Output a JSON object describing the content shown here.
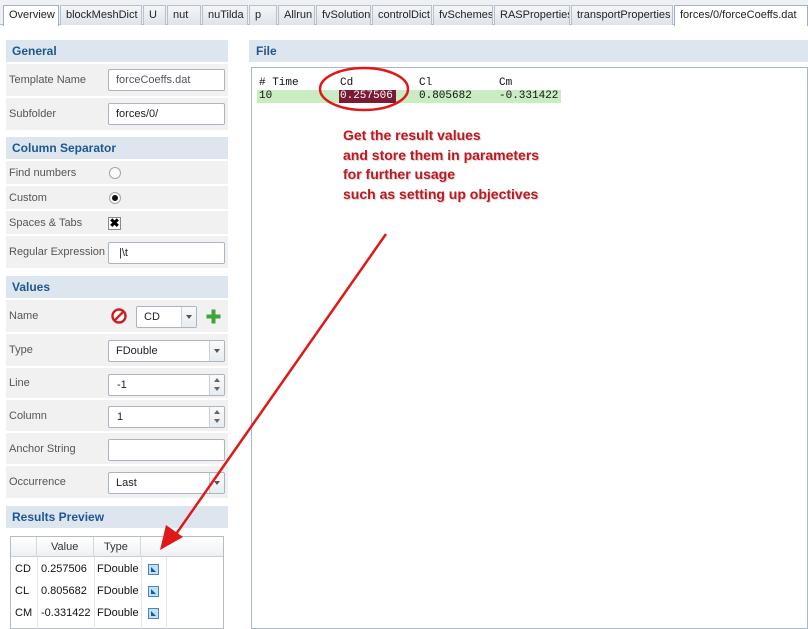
{
  "tabs": [
    {
      "label": "Overview",
      "active": true
    },
    {
      "label": "blockMeshDict",
      "active": false
    },
    {
      "label": "U",
      "active": false
    },
    {
      "label": "nut",
      "active": false
    },
    {
      "label": "nuTilda",
      "active": false
    },
    {
      "label": "p",
      "active": false
    },
    {
      "label": "Allrun",
      "active": false
    },
    {
      "label": "fvSolution",
      "active": false
    },
    {
      "label": "controlDict",
      "active": false
    },
    {
      "label": "fvSchemes",
      "active": false
    },
    {
      "label": "RASProperties",
      "active": false
    },
    {
      "label": "transportProperties",
      "active": false
    },
    {
      "label": "forces/0/forceCoeffs.dat",
      "active": true
    }
  ],
  "general": {
    "title": "General",
    "template_name_label": "Template Name",
    "template_name_value": "forceCoeffs.dat",
    "subfolder_label": "Subfolder",
    "subfolder_value": "forces/0/"
  },
  "column_separator": {
    "title": "Column Separator",
    "find_numbers_label": "Find numbers",
    "find_numbers_selected": false,
    "custom_label": "Custom",
    "custom_selected": true,
    "spaces_tabs_label": "Spaces & Tabs",
    "spaces_tabs_checked": true,
    "spaces_tabs_mark": "✖",
    "regex_label": "Regular Expression",
    "regex_value": "|\\t"
  },
  "values": {
    "title": "Values",
    "name_label": "Name",
    "name_value": "CD",
    "type_label": "Type",
    "type_value": "FDouble",
    "line_label": "Line",
    "line_value": "-1",
    "column_label": "Column",
    "column_value": "1",
    "anchor_label": "Anchor String",
    "anchor_value": "",
    "occurrence_label": "Occurrence",
    "occurrence_value": "Last"
  },
  "results_preview": {
    "title": "Results Preview",
    "columns": [
      "Value",
      "Type"
    ],
    "rows": [
      {
        "name": "CD",
        "value": "0.257506",
        "type": "FDouble"
      },
      {
        "name": "CL",
        "value": "0.805682",
        "type": "FDouble"
      },
      {
        "name": "CM",
        "value": "-0.331422",
        "type": "FDouble"
      }
    ]
  },
  "file": {
    "title": "File",
    "header": {
      "time": "# Time",
      "cd": "Cd",
      "cl": "Cl",
      "cm": "Cm"
    },
    "row": {
      "time": "10",
      "cd": "0.257506",
      "cl": "0.805682",
      "cm": "-0.331422"
    }
  },
  "annotation": {
    "lines": [
      "Get the result values",
      "and store them in parameters",
      "for further usage",
      "such as setting up objectives"
    ],
    "color": "#c0171f"
  },
  "colors": {
    "section_header_bg": "#dde6ef",
    "section_header_text": "#1f5690",
    "row_highlight": "#c9ecc2",
    "cell_highlight": "#7a1a35",
    "add_icon": "#3fa43a",
    "remove_icon": "#cc1f1f"
  }
}
